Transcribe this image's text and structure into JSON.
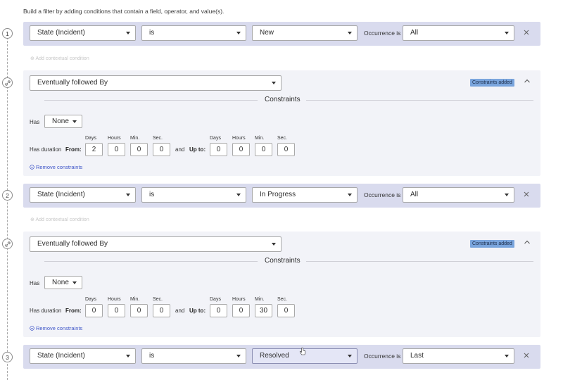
{
  "intro": "Build a filter by adding conditions that contain a field, operator, and value(s).",
  "occurrence_label": "Occurrence is",
  "add_contextual": "Add contextual condition",
  "conditions": [
    {
      "step": "1",
      "field": "State (Incident)",
      "operator": "is",
      "value": "New",
      "occurrence": "All"
    },
    {
      "step": "2",
      "field": "State (Incident)",
      "operator": "is",
      "value": "In Progress",
      "occurrence": "All"
    },
    {
      "step": "3",
      "field": "State (Incident)",
      "operator": "is",
      "value": "Resolved",
      "occurrence": "Last"
    }
  ],
  "constraints": [
    {
      "relation": "Eventually followed By",
      "badge": "Constraints added",
      "title": "Constraints",
      "has_label": "Has",
      "has_value": "None",
      "duration_label": "Has duration",
      "from_label": "From:",
      "and_label": "and",
      "upto_label": "Up to:",
      "units": [
        "Days",
        "Hours",
        "Min.",
        "Sec."
      ],
      "from": [
        "2",
        "0",
        "0",
        "0"
      ],
      "upto": [
        "0",
        "0",
        "0",
        "0"
      ],
      "remove": "Remove constraints"
    },
    {
      "relation": "Eventually followed By",
      "badge": "Constraints added",
      "title": "Constraints",
      "has_label": "Has",
      "has_value": "None",
      "duration_label": "Has duration",
      "from_label": "From:",
      "and_label": "and",
      "upto_label": "Up to:",
      "units": [
        "Days",
        "Hours",
        "Min.",
        "Sec."
      ],
      "from": [
        "0",
        "0",
        "0",
        "0"
      ],
      "upto": [
        "0",
        "0",
        "30",
        "0"
      ],
      "remove": "Remove constraints"
    }
  ]
}
